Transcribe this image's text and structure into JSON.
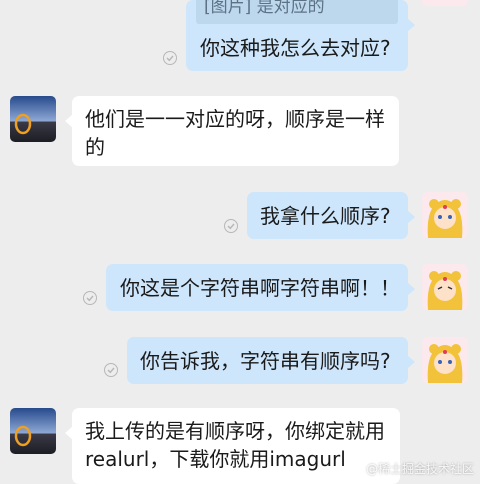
{
  "messages": [
    {
      "side": "out",
      "quote": "[图片] 是对应的",
      "text": "你这种我怎么去对应?"
    },
    {
      "side": "in",
      "text": "他们是一一对应的呀，顺序是一样的"
    },
    {
      "side": "out",
      "text": "我拿什么顺序?"
    },
    {
      "side": "out",
      "text": "你这是个字符串啊字符串啊！！"
    },
    {
      "side": "out",
      "text": "你告诉我，字符串有顺序吗?"
    },
    {
      "side": "in",
      "text": "我上传的是有顺序呀，你绑定就用realurl，下载你就用imagurl"
    }
  ],
  "watermark": "@稀土掘金技术社区",
  "icons": {
    "read_receipt": "check-circle-icon",
    "self_avatar": "anime-girl-avatar",
    "other_avatar": "sky-landscape-avatar"
  },
  "colors": {
    "background": "#ededed",
    "outgoing_bubble": "#cde6fb",
    "incoming_bubble": "#ffffff",
    "quote_background": "#bdd7ec",
    "quote_text": "#5e7286"
  }
}
